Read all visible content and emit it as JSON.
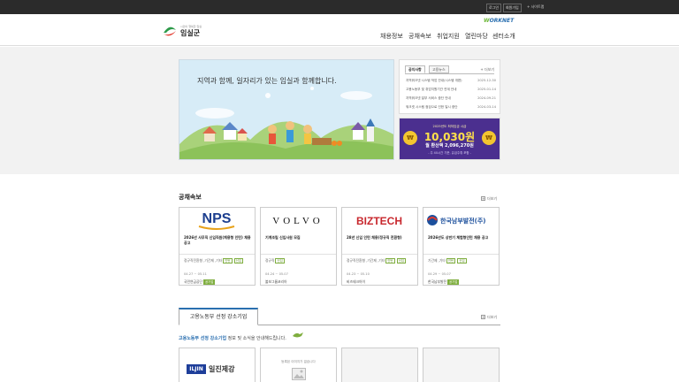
{
  "topbar": {
    "login": "로그인",
    "join": "회원가입",
    "sitemap": "+ 사이트맵"
  },
  "header": {
    "logo_sub": "시민이 행복한 임실",
    "logo_name": "임실군",
    "worknet_w": "W",
    "worknet_rest": "ORKNET",
    "nav": [
      "채용정보",
      "공채속보",
      "취업지원",
      "열린마당",
      "센터소개"
    ]
  },
  "hero": {
    "slogan": "지역과 함께, 일자리가 있는 임실과 함께합니다."
  },
  "notice": {
    "tabs": [
      "공지사항",
      "고용뉴스"
    ],
    "more": "더보기",
    "rows": [
      {
        "title": "지역워크넷 시스템 작업 안내(시스템 개편)",
        "date": "2025-12-30"
      },
      {
        "title": "고용노동부 및 취업지원기관 연계 안내",
        "date": "2025-01-14"
      },
      {
        "title": "지역워크넷 일부 서비스 중단 안내",
        "date": "2024-09-21"
      },
      {
        "title": "워크넷 시스템 점검으로 인한 일시 중단",
        "date": "2024-03-14"
      }
    ]
  },
  "wage": {
    "year": "2025년도 최저임금 시급",
    "hourly": "10,030원",
    "monthly": "월 환산액 2,096,270원",
    "note": "- 주 40시간 기준, 유급주휴 포함 -"
  },
  "news": {
    "title": "공채속보",
    "more": "더보기",
    "cards": [
      {
        "logo": "NPS",
        "title": "2026년 사무직 신입직원(체용형 인턴) 채용 공고",
        "meta": "정규직전환형 ,기간제 ,기타",
        "tag1": "인턴",
        "tag2": "신입",
        "date": "04.27 ~ 05.11",
        "company": "국민연금공단",
        "company_tag": "공기업"
      },
      {
        "logo": "VOLVO",
        "title": "기계조립 신입사원 모집",
        "meta": "정규직",
        "tag1": "신입",
        "tag2": "",
        "date": "04.24 ~ 05.07",
        "company": "볼보그룹코리아",
        "company_tag": ""
      },
      {
        "logo": "BIZTECH",
        "title": "28년 신입 인턴 채용(정규직 전환형)",
        "meta": "정규직전환형 ,기간제 ,기타",
        "tag1": "인턴",
        "tag2": "신입",
        "date": "04.23 ~ 05.10",
        "company": "비즈테크아이",
        "company_tag": ""
      },
      {
        "logo": "한국남부발전(주)",
        "title": "2026년도 상반기 체험형인턴 채용 공고",
        "meta": "기간제 ,기타",
        "tag1": "인턴",
        "tag2": "신입",
        "date": "04.29 ~ 05.07",
        "company": "한국남부발전",
        "company_tag": "공기업"
      }
    ]
  },
  "strong": {
    "tab": "고용노동부 선정 강소기업",
    "more": "더보기",
    "desc_blue": "고용노동부 선정 강소기업",
    "desc_rest": " 정보 및 소식을 안내해드립니다.",
    "cards": [
      {
        "logo_box": "ILJIN",
        "logo_name": "일진제강"
      },
      {
        "noimg": "등록된 이미지가 없습니다"
      }
    ]
  },
  "colors": {
    "accent": "#2a6fb0",
    "wage_bg": "#4b2f8f",
    "tag": "#7fae3f"
  }
}
